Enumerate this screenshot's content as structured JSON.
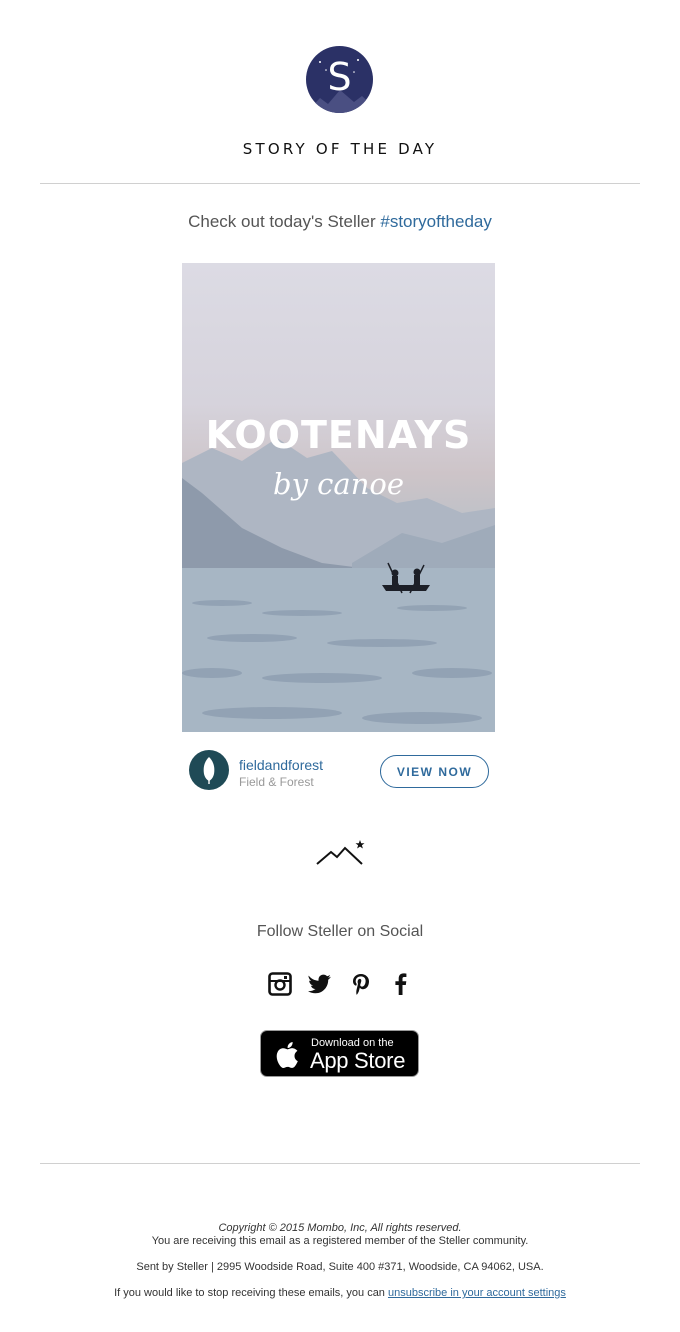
{
  "header": {
    "logo_letter": "S",
    "title": "STORY OF THE DAY"
  },
  "intro": {
    "text": "Check out today's Steller ",
    "hashtag": "#storyoftheday"
  },
  "story": {
    "title": "KOOTENAYS",
    "subtitle": "by canoe",
    "author_handle": "fieldandforest",
    "author_name": "Field & Forest",
    "cta_label": "VIEW NOW"
  },
  "social": {
    "heading": "Follow Steller on Social",
    "icons": [
      "instagram-icon",
      "twitter-icon",
      "pinterest-icon",
      "facebook-icon"
    ]
  },
  "app_store": {
    "line1": "Download on the",
    "line2": "App Store"
  },
  "footer": {
    "copyright": "Copyright © 2015 Mombo, Inc, All rights reserved.",
    "membership": "You are receiving this email as a registered member of the Steller community.",
    "address": "Sent by Steller | 2995 Woodside Road, Suite 400 #371, Woodside, CA 94062, USA.",
    "unsubscribe_prefix": "If you would like to stop receiving these emails, you can ",
    "unsubscribe_link": "unsubscribe in your account settings"
  },
  "colors": {
    "brand_navy": "#2b3166",
    "link_blue": "#2f6a9c",
    "avatar_teal": "#1f4a56"
  }
}
